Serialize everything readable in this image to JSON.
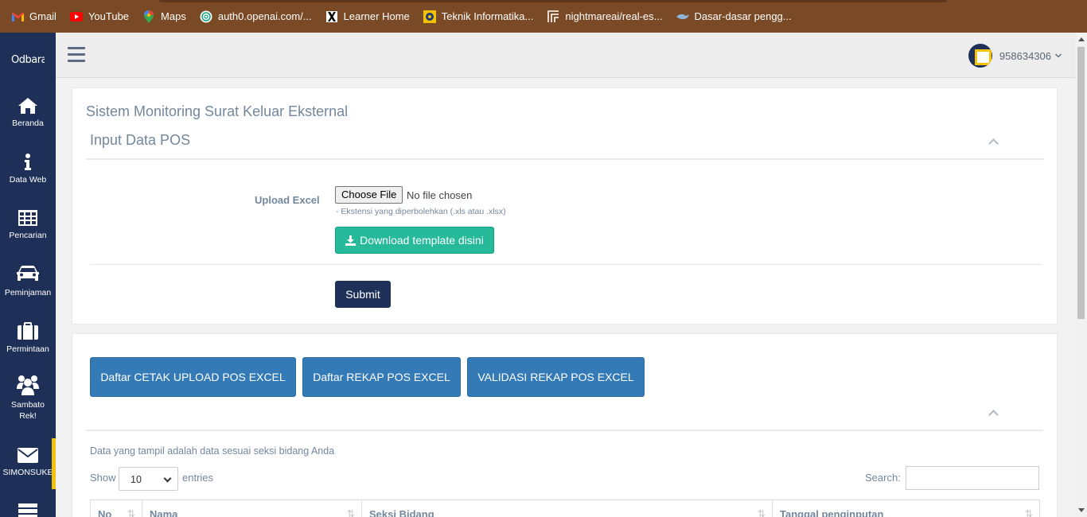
{
  "bookmarks": [
    {
      "label": "Gmail",
      "icon": "gmail-icon"
    },
    {
      "label": "YouTube",
      "icon": "youtube-icon"
    },
    {
      "label": "Maps",
      "icon": "maps-icon"
    },
    {
      "label": "auth0.openai.com/...",
      "icon": "openai-icon"
    },
    {
      "label": "Learner Home",
      "icon": "x-icon"
    },
    {
      "label": "Teknik Informatika...",
      "icon": "university-icon"
    },
    {
      "label": "nightmareai/real-es...",
      "icon": "replicate-icon"
    },
    {
      "label": "Dasar-dasar pengg...",
      "icon": "bird-icon"
    }
  ],
  "sidebar": {
    "logo": "Odbara",
    "items": [
      {
        "label": "Beranda",
        "icon": "home-icon"
      },
      {
        "label": "Data Web",
        "icon": "info-icon"
      },
      {
        "label": "Pencarian",
        "icon": "table-icon"
      },
      {
        "label": "Peminjaman",
        "icon": "car-icon"
      },
      {
        "label": "Permintaan",
        "icon": "briefcase-icon"
      },
      {
        "label": "Sambato Rek!",
        "icon": "users-icon"
      },
      {
        "label": "SIMONSUKE",
        "icon": "envelope-icon"
      }
    ],
    "active_color": "#f4c20d"
  },
  "header": {
    "username": "958634306"
  },
  "page": {
    "title": "Sistem Monitoring Surat Keluar Eksternal"
  },
  "input_panel": {
    "title": "Input Data POS",
    "upload_label": "Upload Excel",
    "file_button": "Choose File",
    "file_status": "No file chosen",
    "hint": "- Ekstensi yang diperbolehkan (.xls atau .xlsx)",
    "download_button": "Download template disini",
    "submit_button": "Submit"
  },
  "list_panel": {
    "buttons": [
      "Daftar CETAK UPLOAD POS EXCEL",
      "Daftar REKAP POS EXCEL",
      "VALIDASI REKAP POS EXCEL"
    ],
    "info_text": "Data yang tampil adalah data sesuai seksi bidang Anda",
    "show_label": "Show",
    "entries_value": "10",
    "entries_label": "entries",
    "search_label": "Search:",
    "search_value": "",
    "columns": [
      "No",
      "Nama",
      "Seksi Bidang",
      "Tanggal penginputan"
    ]
  },
  "colors": {
    "sidebar": "#1e3057",
    "bookmark_bar": "#7a4a26",
    "download_button": "#26b99a",
    "primary_button": "#337ab7",
    "submit_button": "#1e3057"
  }
}
